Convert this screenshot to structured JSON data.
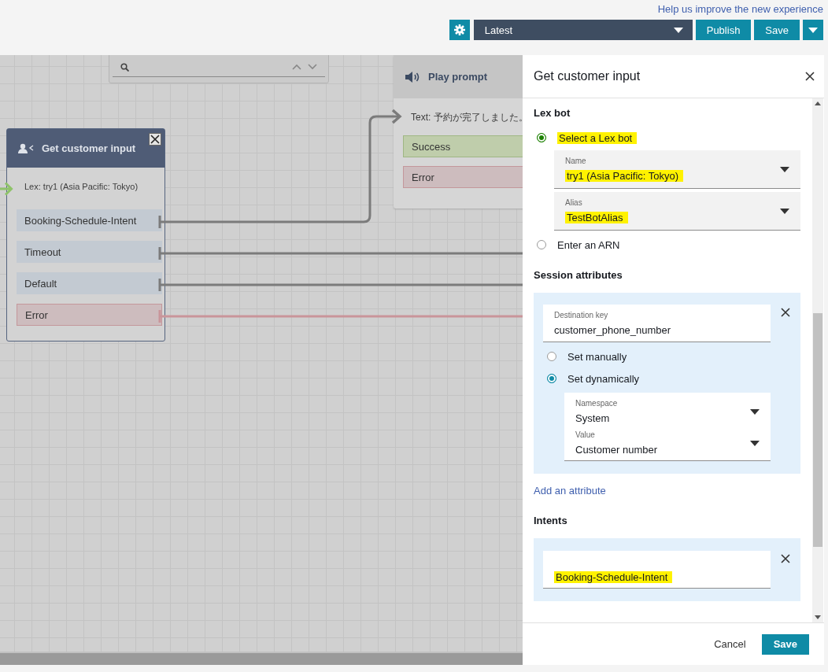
{
  "header": {
    "feedback_link": "Help us improve the new experience",
    "version_select": "Latest",
    "buttons": [
      {
        "label": "Publish"
      },
      {
        "label": "Save"
      }
    ]
  },
  "canvas": {
    "nodes": [
      {
        "kind": "play_prompt",
        "title": "Play prompt",
        "text": "Text: 予約が完了しました。",
        "branches": [
          {
            "label": "Success",
            "kind": "success"
          },
          {
            "label": "Error",
            "kind": "error"
          }
        ]
      },
      {
        "kind": "get_customer_input",
        "title": "Get customer input",
        "text": "Lex: try1 (Asia Pacific: Tokyo)",
        "branches": [
          {
            "label": "Booking-Schedule-Intent",
            "kind": "normal"
          },
          {
            "label": "Timeout",
            "kind": "normal"
          },
          {
            "label": "Default",
            "kind": "normal"
          },
          {
            "label": "Error",
            "kind": "error"
          }
        ]
      }
    ]
  },
  "panel": {
    "title": "Get customer input",
    "lex_bot": {
      "heading": "Lex bot",
      "options": [
        {
          "label": "Select a Lex bot",
          "selected": true,
          "highlighted": true
        },
        {
          "label": "Enter an ARN",
          "selected": false,
          "highlighted": false
        }
      ],
      "fields": [
        {
          "label": "Name",
          "value": "try1 (Asia Pacific: Tokyo)",
          "highlighted": true
        },
        {
          "label": "Alias",
          "value": "TestBotAlias",
          "highlighted": true
        }
      ]
    },
    "session_attributes": {
      "heading": "Session attributes",
      "attributes": [
        {
          "key_label": "Destination key",
          "key_value": "customer_phone_number",
          "modes": [
            {
              "label": "Set manually",
              "selected": false
            },
            {
              "label": "Set dynamically",
              "selected": true
            }
          ],
          "fields": [
            {
              "label": "Namespace",
              "value": "System"
            },
            {
              "label": "Value",
              "value": "Customer number"
            }
          ]
        }
      ],
      "add_link": "Add an attribute"
    },
    "intents": {
      "heading": "Intents",
      "items": [
        {
          "value": "Booking-Schedule-Intent",
          "highlighted": true
        }
      ]
    },
    "footer_buttons": [
      {
        "label": "Cancel",
        "kind": "secondary"
      },
      {
        "label": "Save",
        "kind": "primary"
      }
    ]
  }
}
